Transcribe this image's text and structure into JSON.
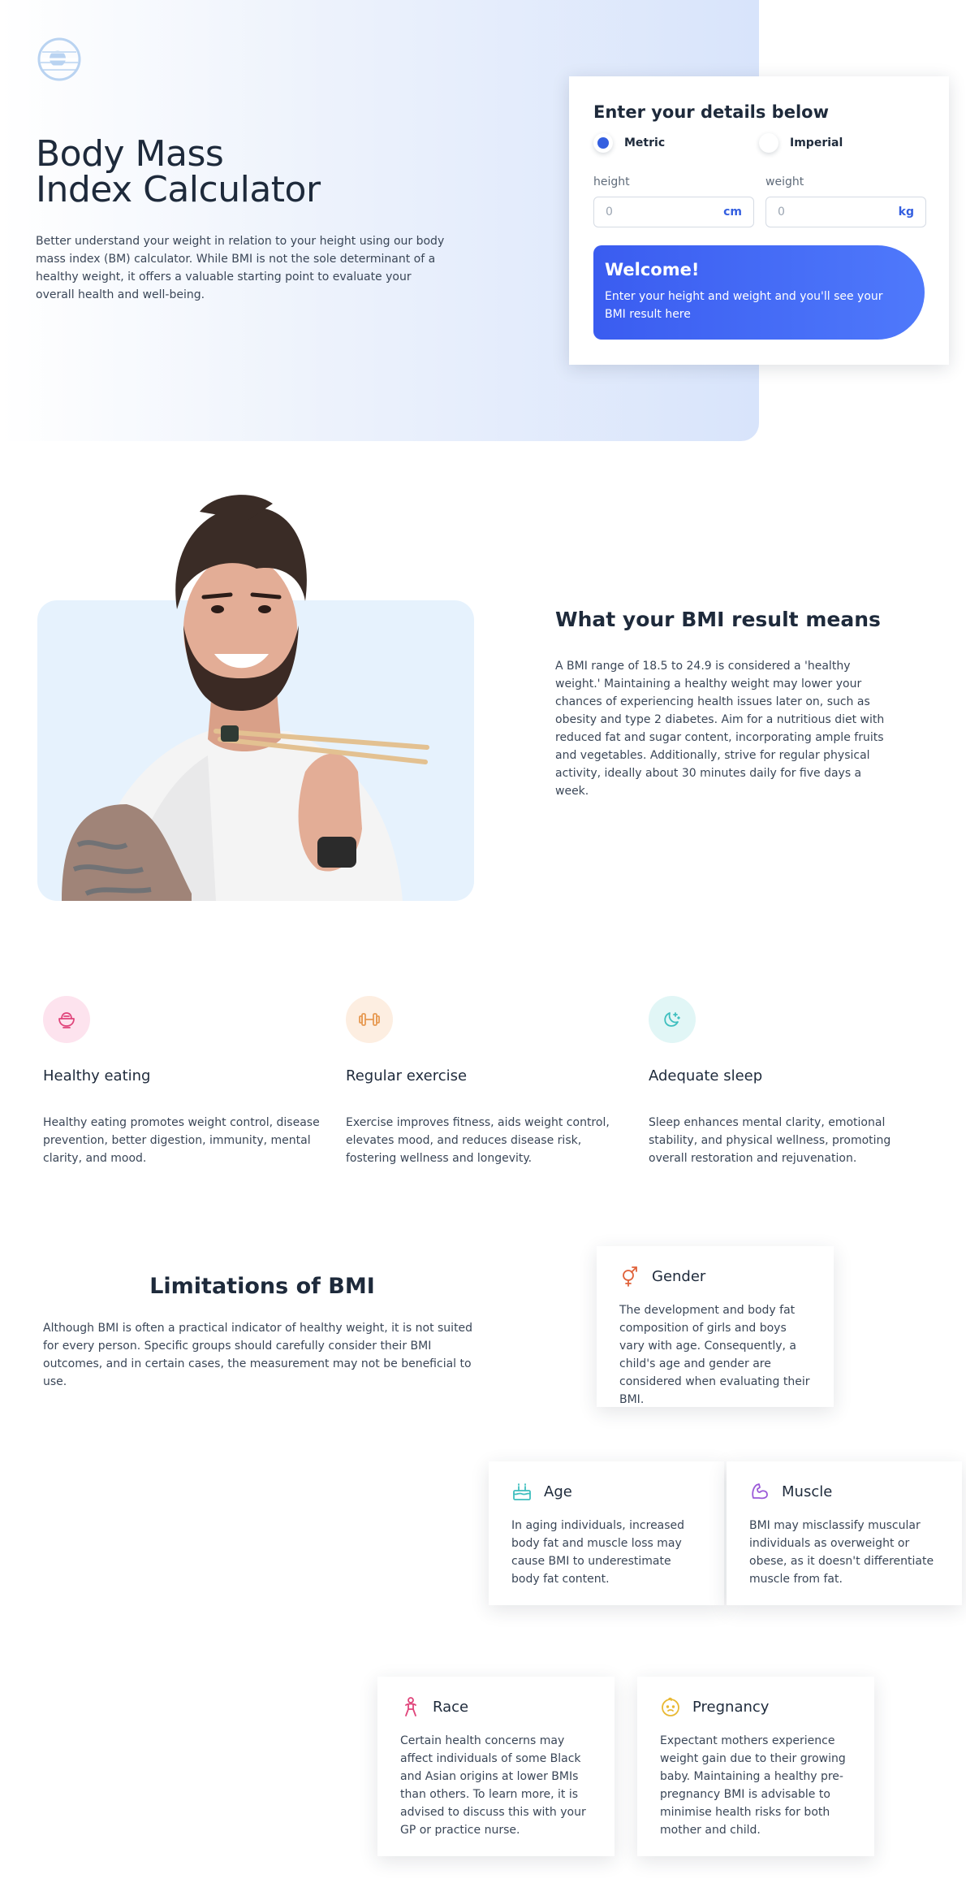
{
  "hero": {
    "title_line1": "Body Mass",
    "title_line2": "Index Calculator",
    "description": "Better understand your weight in relation to your height using our body mass index (BM) calculator. While BMI is not the sole determinant of a healthy weight, it offers a valuable starting point to evaluate your overall health and well-being.",
    "logo_icon": "sun-stripes-logo"
  },
  "calculator": {
    "title": "Enter your details below",
    "units": [
      {
        "label": "Metric",
        "selected": true
      },
      {
        "label": "Imperial",
        "selected": false
      }
    ],
    "height": {
      "label": "height",
      "value": "0",
      "unit": "cm"
    },
    "weight": {
      "label": "weight",
      "value": "0",
      "unit": "kg"
    },
    "welcome_title": "Welcome!",
    "welcome_text": "Enter your height and weight and you'll see your BMI result here"
  },
  "meaning": {
    "title": "What your BMI result means",
    "text": "A BMI range of 18.5 to 24.9 is considered a 'healthy weight.' Maintaining a healthy weight may lower your chances of experiencing health issues later on, such as obesity and type 2 diabetes. Aim for a nutritious diet with reduced fat and sugar content, incorporating ample fruits and vegetables. Additionally, strive for regular physical activity, ideally about 30 minutes daily for five days a week."
  },
  "features": [
    {
      "title": "Healthy eating",
      "text": "Healthy eating promotes weight control, disease prevention, better digestion, immunity, mental clarity, and mood.",
      "icon": "bowl-icon",
      "color": "#e0457b",
      "bg": "#fde3ee"
    },
    {
      "title": "Regular exercise",
      "text": "Exercise improves fitness, aids weight control, elevates mood, and reduces disease risk, fostering wellness and longevity.",
      "icon": "dumbbell-icon",
      "color": "#e79a52",
      "bg": "#fdeee1"
    },
    {
      "title": "Adequate sleep",
      "text": "Sleep enhances mental clarity, emotional stability, and physical wellness, promoting overall restoration and rejuvenation.",
      "icon": "moon-icon",
      "color": "#3fbfbf",
      "bg": "#e1f6f6"
    }
  ],
  "limitations": {
    "title": "Limitations of BMI",
    "text": "Although BMI is often a practical indicator of healthy weight, it is not suited for every person. Specific groups should carefully consider their BMI outcomes, and in certain cases, the measurement may not be beneficial to use.",
    "cards": {
      "gender": {
        "title": "Gender",
        "text": "The development and body fat composition of girls and boys vary with age. Consequently, a child's age and gender are considered when evaluating their BMI.",
        "icon": "gender-icon",
        "color": "#e0623a"
      },
      "age": {
        "title": "Age",
        "text": "In aging individuals, increased body fat and muscle loss may cause BMI to underestimate body fat content.",
        "icon": "birthday-cake-icon",
        "color": "#3fbfbf"
      },
      "muscle": {
        "title": "Muscle",
        "text": "BMI may misclassify muscular individuals as overweight or obese, as it doesn't differentiate muscle from fat.",
        "icon": "flexed-bicep-icon",
        "color": "#9b5ad8"
      },
      "race": {
        "title": "Race",
        "text": "Certain health concerns may affect individuals of some Black and Asian origins at lower BMIs than others. To learn more, it is advised to discuss this with your GP or practice nurse.",
        "icon": "person-icon",
        "color": "#e0457b"
      },
      "pregnancy": {
        "title": "Pregnancy",
        "text": "Expectant mothers experience weight gain due to their growing baby. Maintaining a healthy pre-pregnancy BMI is advisable to minimise health risks for both mother and child.",
        "icon": "baby-face-icon",
        "color": "#e9b934"
      }
    }
  }
}
